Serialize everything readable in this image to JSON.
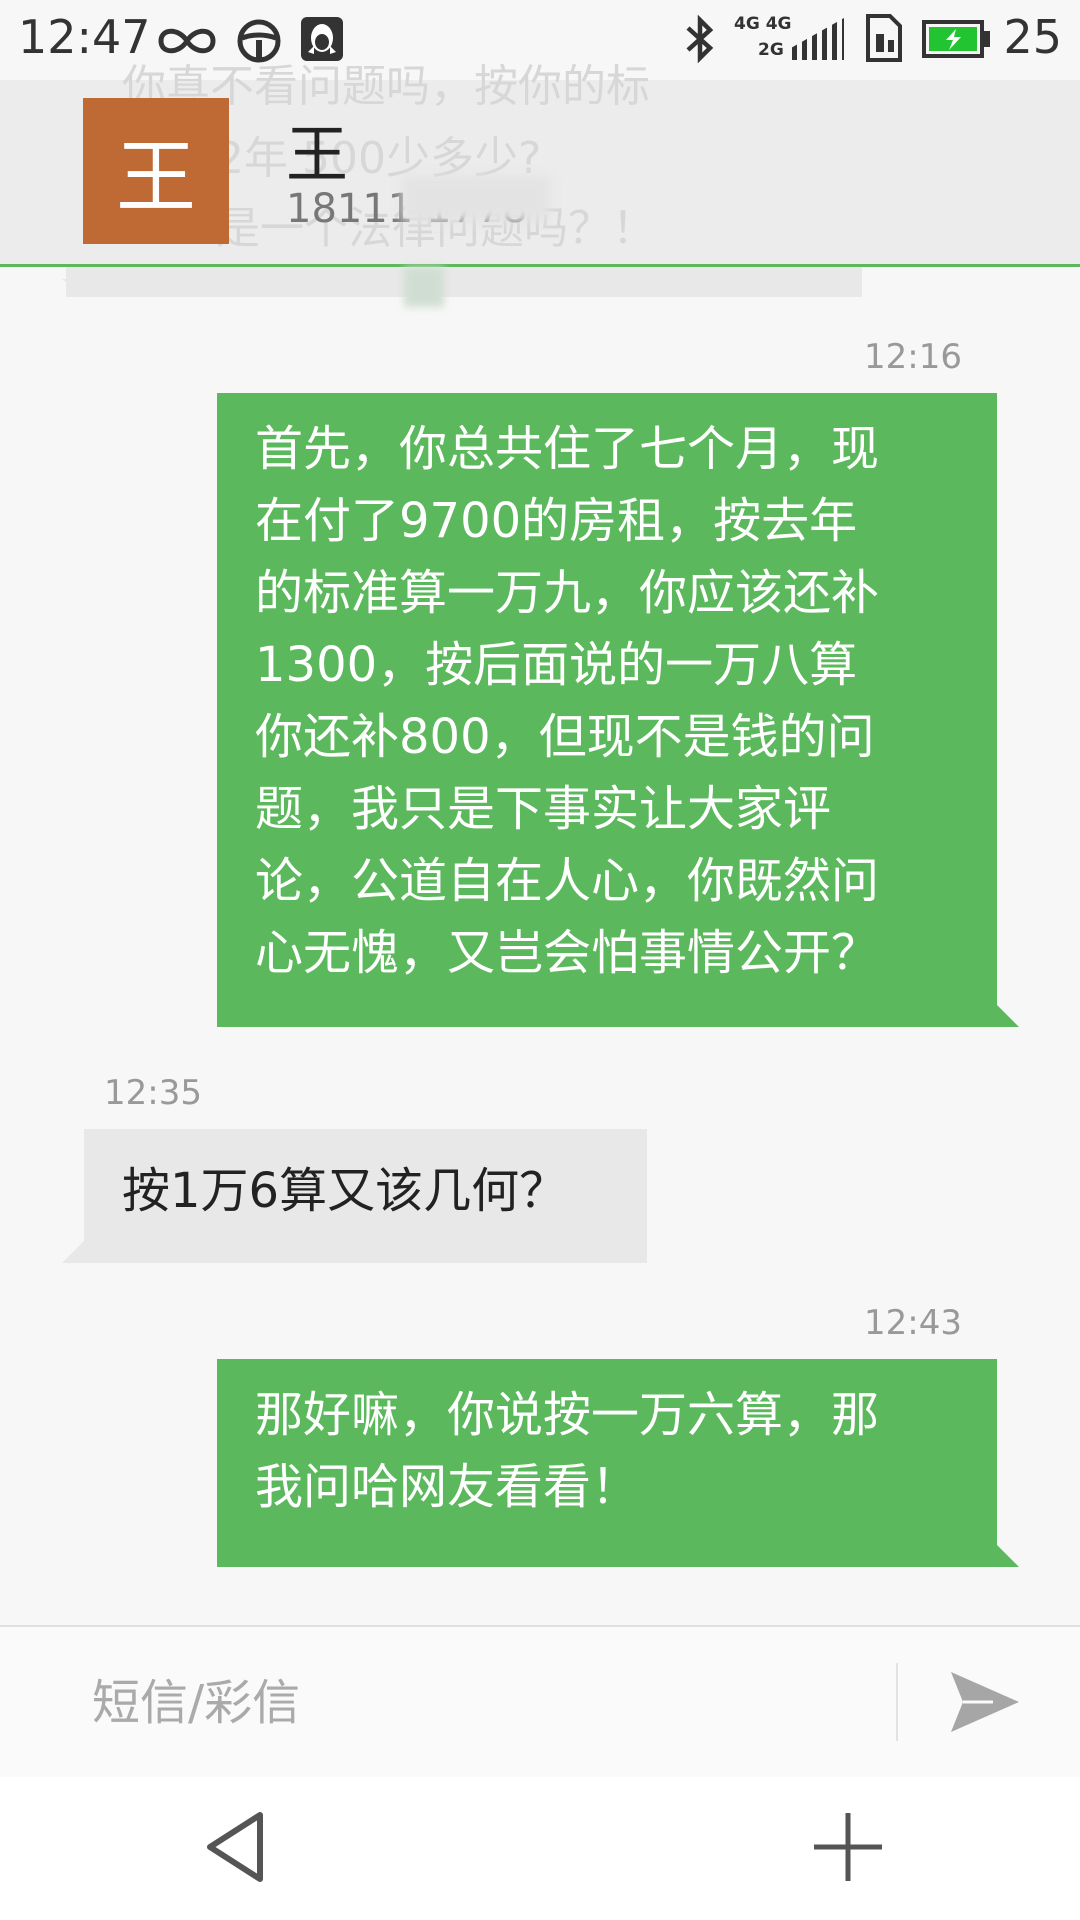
{
  "status_bar": {
    "time": "12:47",
    "network_top": "4G 4G",
    "network_bottom": "2G",
    "battery_level": "25",
    "icons": [
      "infinity-icon",
      "steering-wheel-icon",
      "qq-penguin-icon",
      "bluetooth-icon",
      "signal-icon",
      "sim-icon",
      "battery-icon"
    ]
  },
  "header": {
    "ghost_lines": [
      "你真不看问题吗，按你的标",
      "2年 500少多少?",
      "是一个法律问题吗？！"
    ],
    "avatar_letter": "王",
    "contact_name": "王",
    "contact_number": "18111 1778"
  },
  "messages": [
    {
      "direction": "outgoing",
      "time": "12:16",
      "lines": [
        "首先，你总共住了七个月，现",
        "在付了9700的房租，按去年",
        "的标准算一万九，你应该还补",
        "1300，按后面说的一万八算",
        "你还补800，但现不是钱的问",
        "题，我只是下事实让大家评",
        "论，公道自在人心，你既然问",
        "心无愧，又岂会怕事情公开？"
      ]
    },
    {
      "direction": "incoming",
      "time": "12:35",
      "lines": [
        "按1万6算又该几何？"
      ]
    },
    {
      "direction": "outgoing",
      "time": "12:43",
      "lines": [
        "那好嘛，你说按一万六算，那",
        "我问哈网友看看！"
      ]
    }
  ],
  "composer": {
    "placeholder": "短信/彩信",
    "value": "",
    "send_icon": "send-arrow-icon"
  },
  "nav": {
    "back_icon": "back-triangle-icon",
    "add_icon": "plus-icon"
  },
  "colors": {
    "accent_green": "#5cb85c",
    "incoming_bubble": "#e8e8e8",
    "avatar_bg": "#bf6a34",
    "battery_green": "#22c431"
  }
}
